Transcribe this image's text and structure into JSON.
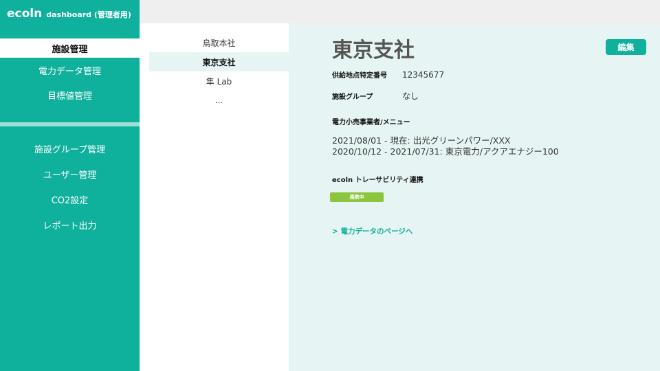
{
  "brand": {
    "main": "ecoln",
    "sub": "dashboard (管理者用)"
  },
  "sidebar": {
    "items_top": [
      {
        "label": "施設管理",
        "active": true
      },
      {
        "label": "電力データ管理"
      },
      {
        "label": "目標値管理"
      }
    ],
    "items_bottom": [
      {
        "label": "施設グループ管理"
      },
      {
        "label": "ユーザー管理"
      },
      {
        "label": "CO2設定"
      },
      {
        "label": "レポート出力"
      }
    ]
  },
  "facilities": [
    {
      "label": "鳥取本社"
    },
    {
      "label": "東京支社",
      "selected": true
    },
    {
      "label": "隼 Lab"
    },
    {
      "label": "..."
    }
  ],
  "detail": {
    "title": "東京支社",
    "edit_label": "編集",
    "supply_point": {
      "label": "供給地点特定番号",
      "value": "12345677"
    },
    "facility_group": {
      "label": "施設グループ",
      "value": "なし"
    },
    "retailer_label": "電力小売事業者/メニュー",
    "retailer_lines": [
      "2021/08/01  - 現在: 出光グリーンパワー/XXX",
      "2020/10/12  - 2021/07/31:  東京電力/アクアエナジー100"
    ],
    "trace_label": "ecoln トレーサビリティ連携",
    "trace_status": "連携中",
    "power_link": "> 電力データのページへ"
  },
  "colors": {
    "accent": "#0fb09c",
    "panel": "#e6f5f3",
    "status_ok": "#8cc63f",
    "topbar": "#efefef"
  }
}
